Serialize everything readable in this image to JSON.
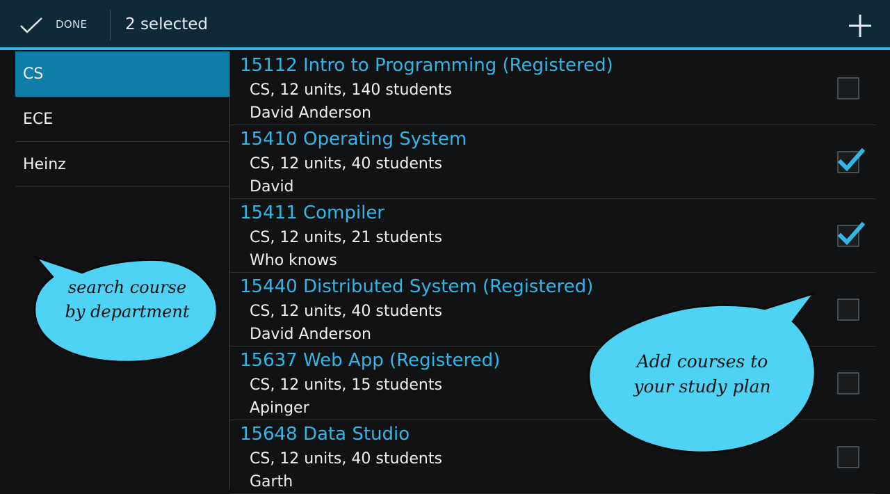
{
  "action_bar": {
    "done_label": "DONE",
    "title": "2 selected",
    "icons": {
      "done": "check-icon",
      "add": "plus-icon"
    }
  },
  "departments": [
    {
      "label": "CS",
      "selected": true
    },
    {
      "label": "ECE",
      "selected": false
    },
    {
      "label": "Heinz",
      "selected": false
    }
  ],
  "courses": [
    {
      "title": "15112 Intro to Programming (Registered)",
      "meta": "CS, 12 units, 140 students",
      "instructor": "David Anderson",
      "checked": false
    },
    {
      "title": "15410 Operating System",
      "meta": "CS, 12 units, 40 students",
      "instructor": "David",
      "checked": true
    },
    {
      "title": "15411 Compiler",
      "meta": "CS, 12 units, 21 students",
      "instructor": "Who knows",
      "checked": true
    },
    {
      "title": "15440 Distributed System (Registered)",
      "meta": "CS, 12 units, 40 students",
      "instructor": "David Anderson",
      "checked": false
    },
    {
      "title": "15637 Web App (Registered)",
      "meta": "CS, 12 units, 15 students",
      "instructor": "Apinger",
      "checked": false
    },
    {
      "title": "15648 Data Studio",
      "meta": "CS, 12 units, 40 students",
      "instructor": "Garth",
      "checked": false
    }
  ],
  "callouts": {
    "department": {
      "line1": "search course",
      "line2": "by department"
    },
    "add_courses": {
      "line1": "Add courses to",
      "line2": "your study plan"
    }
  },
  "colors": {
    "accent": "#33b5e5",
    "action_bar_bg": "#0d2a36",
    "selected_dept_bg": "#0e7ea8",
    "bubble_fill": "#4fd3f5",
    "background": "#111213"
  }
}
